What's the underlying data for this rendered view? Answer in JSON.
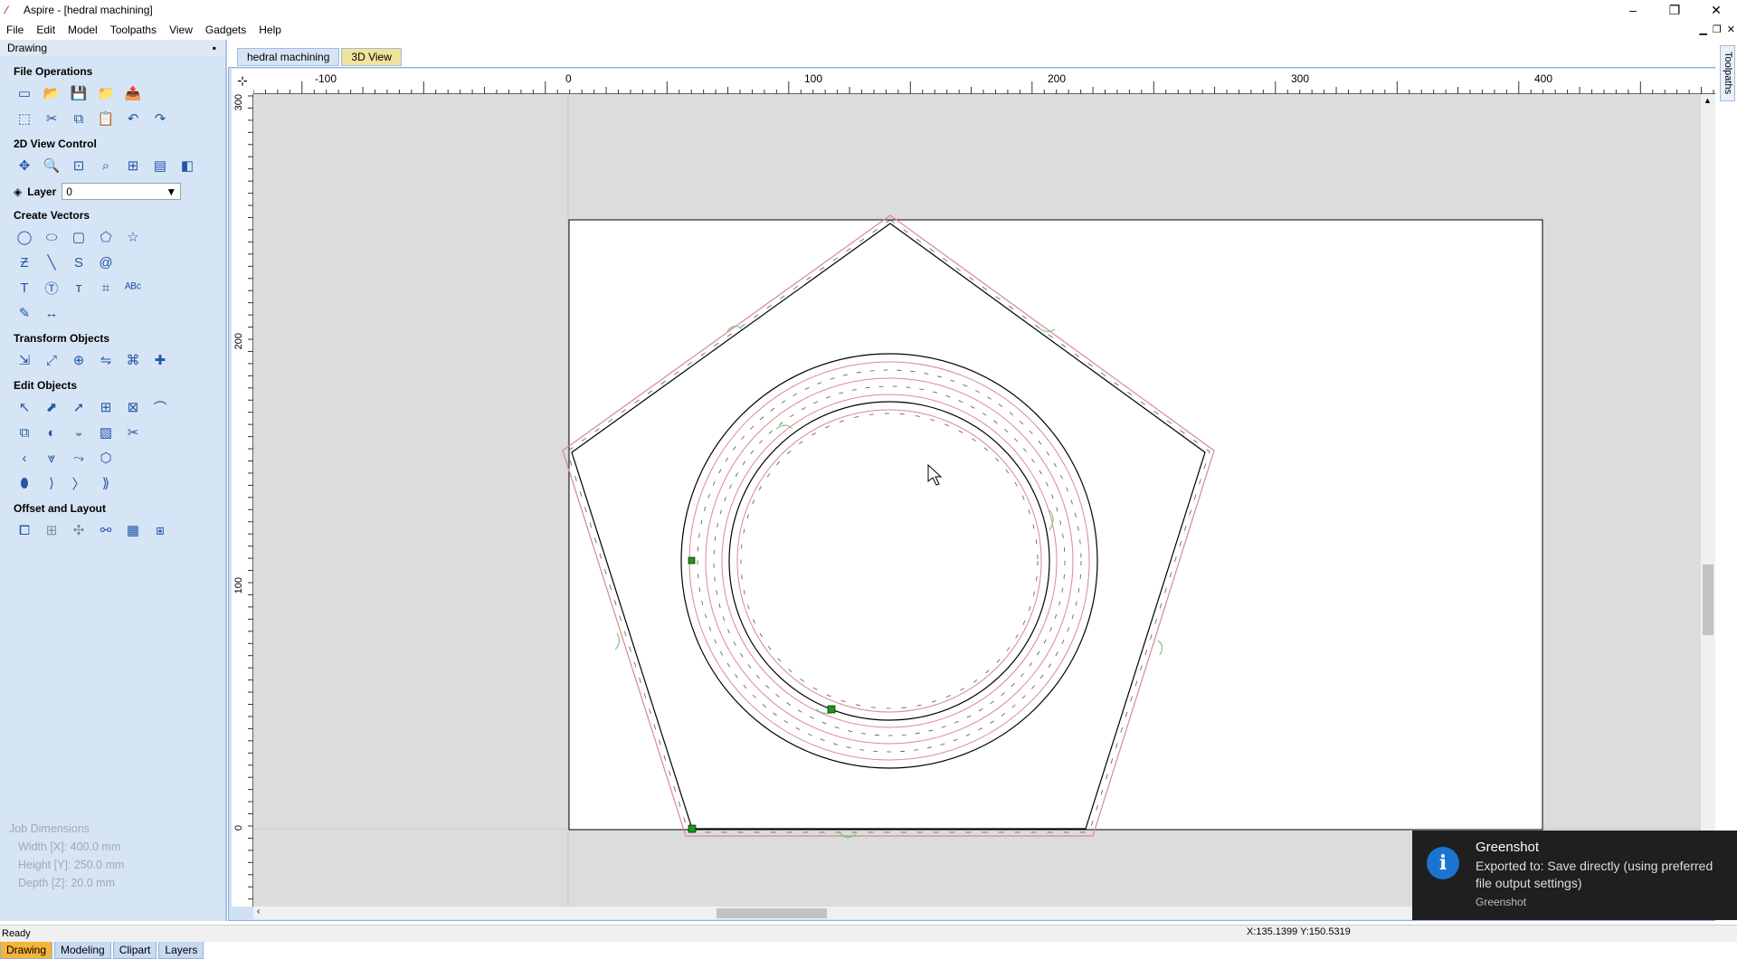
{
  "window": {
    "title": "Aspire - [hedral machining]",
    "controls": {
      "minimize": "–",
      "restore": "❐",
      "close": "✕"
    }
  },
  "menu": [
    "File",
    "Edit",
    "Model",
    "Toolpaths",
    "View",
    "Gadgets",
    "Help"
  ],
  "panel": {
    "title": "Drawing",
    "pin": "📌",
    "sections": {
      "file_ops": "File Operations",
      "view_control": "2D View Control",
      "create_vectors": "Create Vectors",
      "transform": "Transform Objects",
      "edit": "Edit Objects",
      "offset": "Offset and Layout"
    },
    "layer_label": "Layer",
    "layer_value": "0"
  },
  "job": {
    "title": "Job Dimensions",
    "width": "Width  [X]: 400.0 mm",
    "height": "Height [Y]: 250.0 mm",
    "depth": "Depth  [Z]: 20.0 mm"
  },
  "bottom_tabs": [
    "Drawing",
    "Modeling",
    "Clipart",
    "Layers"
  ],
  "doc_tabs": [
    "hedral machining",
    "3D View"
  ],
  "side_tab": "Toolpaths",
  "ruler": {
    "top": [
      "-100",
      "0",
      "100",
      "200",
      "300",
      "400"
    ],
    "left": [
      "300",
      "200",
      "100",
      "0"
    ]
  },
  "status": {
    "text": "Ready",
    "coords": "X:135.1399 Y:150.5319"
  },
  "toast": {
    "app": "Greenshot",
    "message": "Exported to: Save directly (using preferred file output settings)",
    "source": "Greenshot",
    "icon": "i"
  }
}
